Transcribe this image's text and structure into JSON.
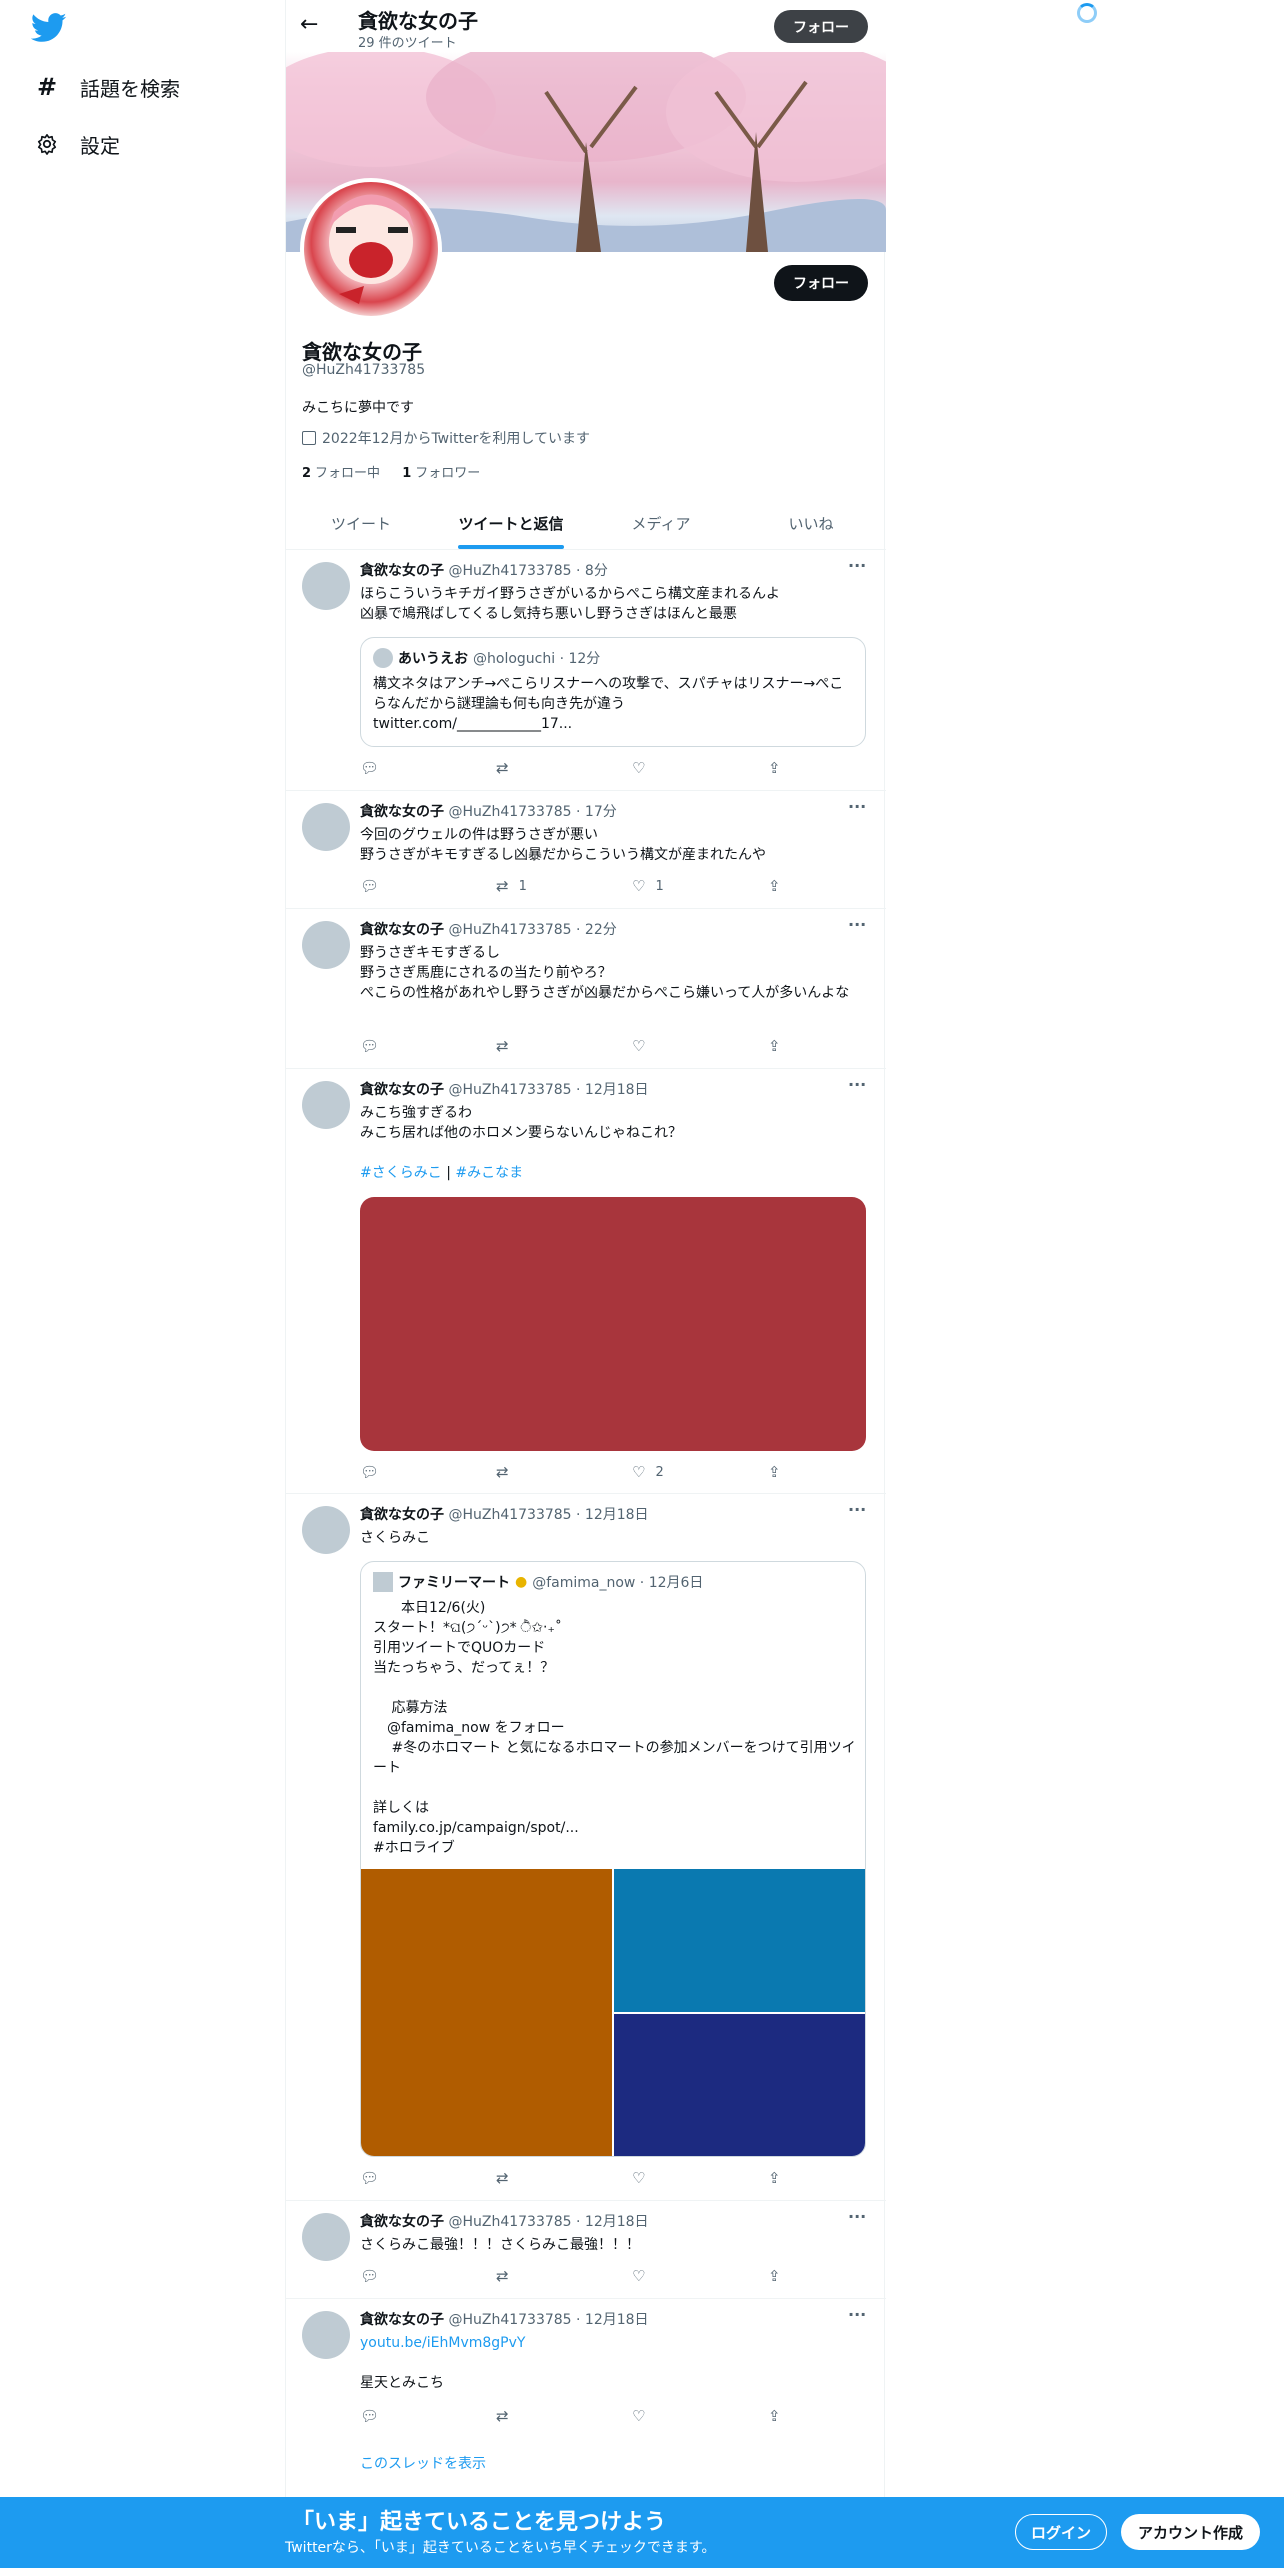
{
  "nav": {
    "explore": "話題を検索",
    "settings": "設定"
  },
  "header": {
    "name": "貪欲な女の子",
    "tweet_count": "29 件のツイート",
    "follow": "フォロー"
  },
  "profile": {
    "name": "貪欲な女の子",
    "handle": "@HuZh41733785",
    "bio": "みこちに夢中です",
    "joined": "2022年12月からTwitterを利用しています",
    "following_count": "2",
    "following_label": "フォロー中",
    "followers_count": "1",
    "followers_label": "フォロワー",
    "follow": "フォロー"
  },
  "tabs": [
    "ツイート",
    "ツイートと返信",
    "メディア",
    "いいね"
  ],
  "tweets": [
    {
      "name": "貪欲な女の子",
      "meta": "@HuZh41733785 · 8分",
      "text": "ほらこういうキチガイ野うさぎがいるからぺこら構文産まれるんよ\n凶暴で鳩飛ばしてくるし気持ち悪いし野うさぎはほんと最悪",
      "quote": {
        "name": "あいうえお",
        "meta": "@hologuchi · 12分",
        "text": "構文ネタはアンチ→ぺこらリスナーへの攻撃で、スパチャはリスナー→ぺこらなんだから謎理論も何も向き先が違う\ntwitter.com/____________17..."
      },
      "retweets": "",
      "likes": ""
    },
    {
      "name": "貪欲な女の子",
      "meta": "@HuZh41733785 · 17分",
      "text": "今回のグウェルの件は野うさぎが悪い\n野うさぎがキモすぎるし凶暴だからこういう構文が産まれたんや",
      "retweets": "1",
      "likes": "1"
    },
    {
      "name": "貪欲な女の子",
      "meta": "@HuZh41733785 · 22分",
      "text": "野うさぎキモすぎるし\n野うさぎ馬鹿にされるの当たり前やろ？\nぺこらの性格があれやし野うさぎが凶暴だからぺこら嫌いって人が多いんよな",
      "retweets": "",
      "likes": ""
    },
    {
      "name": "貪欲な女の子",
      "meta": "@HuZh41733785 · 12月18日",
      "text": "みこち強すぎるわ\nみこち居れば他のホロメン要らないんじゃねこれ？",
      "hashtag1": "#さくらみこ",
      "separator": "|",
      "hashtag2": "#みこなま",
      "image_color": "#a8353c",
      "retweets": "",
      "likes": "2"
    },
    {
      "name": "貪欲な女の子",
      "meta": "@HuZh41733785 · 12月18日",
      "text": "さくらみこ",
      "quote": {
        "name": "ファミリーマート",
        "meta": "@famima_now · 12月6日",
        "text": "　　本日12/6(火)\nスタート！*ଘ(੭ˊᵕˋ)੭* ੈ✩‧₊˚\n引用ツイートでQUOカード\n当たっちゃう、だってぇ！？\n\n　 応募方法\n　@famima_now をフォロー\n　 #冬のホロマート と気になるホロマートの参加メンバーをつけて引用ツイート\n\n詳しくは\nfamily.co.jp/campaign/spot/...\n#ホロライブ",
        "images": [
          "#b05c00",
          "#0a79b0",
          "#1c2a80"
        ]
      },
      "retweets": "",
      "likes": ""
    },
    {
      "name": "貪欲な女の子",
      "meta": "@HuZh41733785 · 12月18日",
      "text": "さくらみこ最強！！！さくらみこ最強！！！",
      "retweets": "",
      "likes": ""
    },
    {
      "name": "貪欲な女の子",
      "meta": "@HuZh41733785 · 12月18日",
      "link": "youtu.be/iEhMvm8gPvY",
      "text": "星天とみこち",
      "show_thread": "このスレッドを表示",
      "retweets": "",
      "likes": ""
    }
  ],
  "banner": {
    "title": "「いま」起きていることを見つけよう",
    "subtitle": "Twitterなら、「いま」起きていることをいち早くチェックできます。",
    "login": "ログイン",
    "signup": "アカウント作成"
  },
  "colors": {
    "accent": "#1d9bf0",
    "text": "#0f1419",
    "muted": "#536471"
  }
}
